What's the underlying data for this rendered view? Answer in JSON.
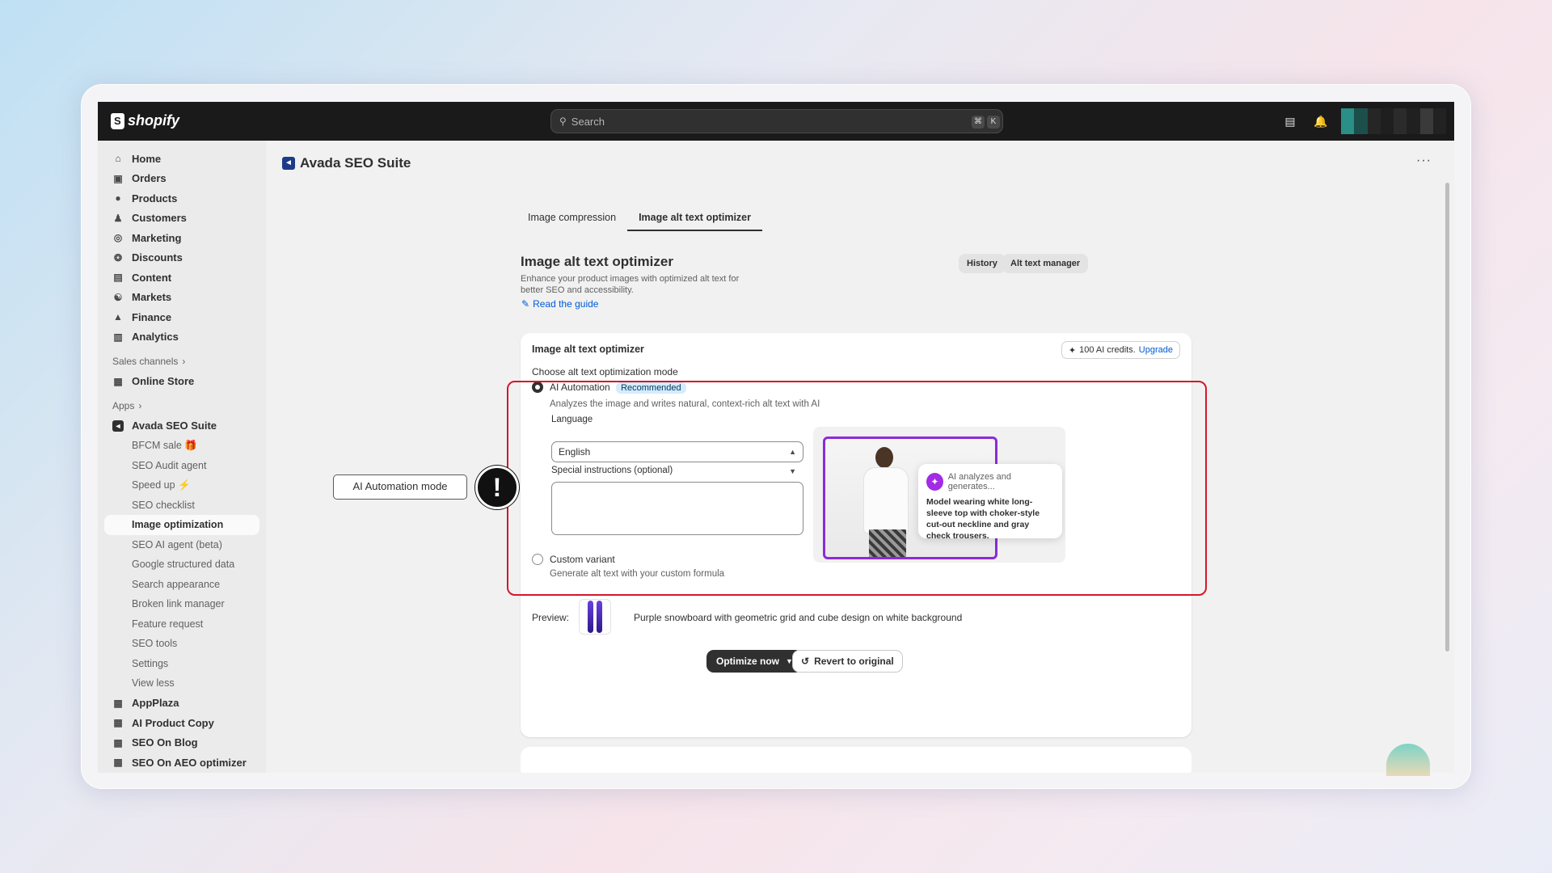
{
  "topbar": {
    "brand": "shopify",
    "search_placeholder": "Search",
    "kbd1": "⌘",
    "kbd2": "K"
  },
  "sidebar": {
    "main": [
      {
        "label": "Home",
        "icon": "home-icon"
      },
      {
        "label": "Orders",
        "icon": "orders-icon"
      },
      {
        "label": "Products",
        "icon": "tag-icon"
      },
      {
        "label": "Customers",
        "icon": "person-icon"
      },
      {
        "label": "Marketing",
        "icon": "target-icon"
      },
      {
        "label": "Discounts",
        "icon": "discount-icon"
      },
      {
        "label": "Content",
        "icon": "content-icon"
      },
      {
        "label": "Markets",
        "icon": "globe-icon"
      },
      {
        "label": "Finance",
        "icon": "bank-icon"
      },
      {
        "label": "Analytics",
        "icon": "chart-icon"
      }
    ],
    "sales_channels": "Sales channels",
    "online_store": "Online Store",
    "apps": "Apps",
    "avada": "Avada SEO Suite",
    "sub": [
      "BFCM sale 🎁",
      "SEO Audit agent",
      "Speed up ⚡",
      "SEO checklist",
      "Image optimization",
      "SEO AI agent (beta)",
      "Google structured data",
      "Search appearance",
      "Broken link manager",
      "Feature request",
      "SEO tools",
      "Settings",
      "View less"
    ],
    "more_apps": [
      "AppPlaza",
      "AI Product Copy",
      "SEO On Blog",
      "SEO On AEO optimizer"
    ]
  },
  "app": {
    "title": "Avada SEO Suite",
    "more": "···"
  },
  "tabs": [
    "Image compression",
    "Image alt text optimizer"
  ],
  "page": {
    "title": "Image alt text optimizer",
    "description": "Enhance your product images with optimized alt text for better SEO and accessibility.",
    "guide": "Read the guide",
    "history": "History",
    "alt_manager": "Alt text manager"
  },
  "card": {
    "title": "Image alt text optimizer",
    "credits": "100 AI credits.",
    "upgrade": "Upgrade",
    "choose": "Choose alt text optimization mode",
    "ai_label": "AI Automation",
    "recommended": "Recommended",
    "ai_desc": "Analyzes the image and writes natural, context-rich alt text with AI",
    "language_label": "Language",
    "language_value": "English",
    "special_label": "Special instructions (optional)",
    "tip_head": "AI analyzes and generates...",
    "tip_body": "Model wearing white long-sleeve top with choker-style cut-out neckline and gray check trousers.",
    "custom_label": "Custom variant",
    "custom_desc": "Generate alt text with your custom formula",
    "preview_label": "Preview:",
    "preview_text": "Purple snowboard with geometric grid and cube design on white background",
    "optimize": "Optimize now",
    "revert": "Revert to original"
  },
  "annotation": {
    "callout": "AI Automation mode",
    "mark": "!"
  },
  "colors": {
    "accent": "#005bd3",
    "highlight": "#d5172b",
    "ai_purple": "#a12be6"
  }
}
